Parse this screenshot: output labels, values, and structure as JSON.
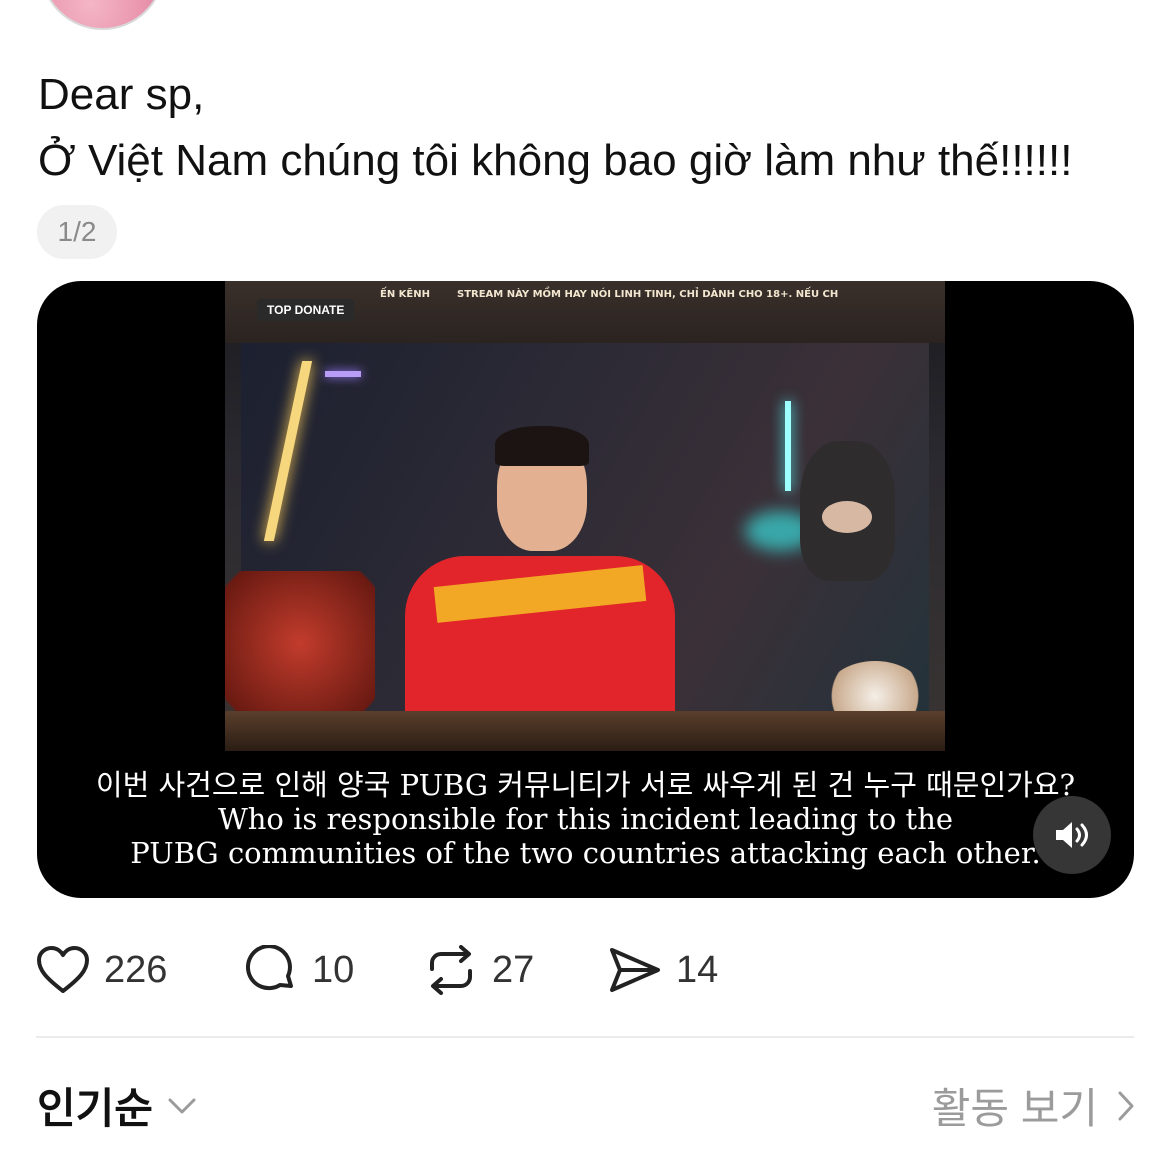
{
  "post": {
    "text_lines": [
      "Dear sp,",
      "Ở Việt Nam chúng tôi không bao giờ làm như thế!!!!!!"
    ],
    "media_counter": "1/2"
  },
  "video": {
    "overlay_texts": {
      "top_donate": "TOP DONATE",
      "ticker_left": "ẾN KÊNH",
      "ticker_right": "STREAM NÀY MỒM HAY NÓI LINH TINH, CHỈ DÀNH CHO 18+. NẾU CH"
    },
    "subtitles": [
      "이번 사건으로 인해 양국 PUBG 커뮤니티가 서로 싸우게 된 건 누구 때문인가요?",
      "Who is responsible for this incident leading to the",
      "PUBG communities of the two countries attacking each other."
    ],
    "sound_icon": "speaker-sound-icon"
  },
  "actions": {
    "like": {
      "icon": "heart-icon",
      "count": "226"
    },
    "comment": {
      "icon": "comment-icon",
      "count": "10"
    },
    "repost": {
      "icon": "repost-icon",
      "count": "27"
    },
    "share": {
      "icon": "send-icon",
      "count": "14"
    }
  },
  "footer": {
    "sort_label": "인기순",
    "activity_label": "활동 보기"
  },
  "colors": {
    "text": "#111111",
    "muted": "#9b9b9b",
    "counter_bg": "#f1f1f1",
    "media_bg": "#000000"
  }
}
